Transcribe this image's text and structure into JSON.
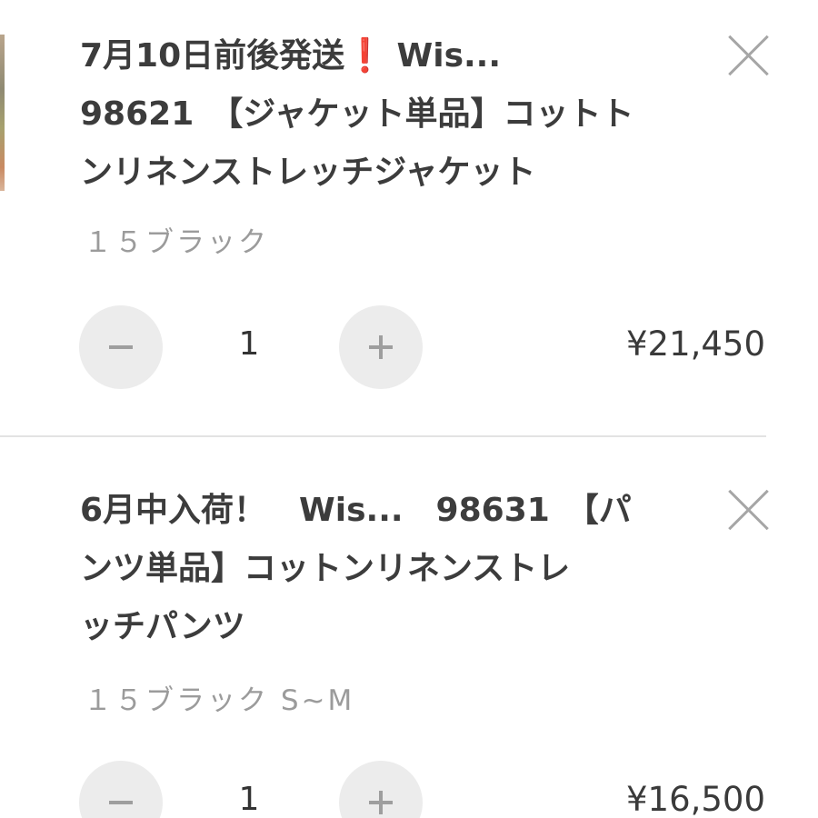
{
  "cart_items": [
    {
      "title_lines": [
        "7月10日前後発送",
        "98621　【ジャケット単品】コットト",
        "ンリネンストレッチジャケット"
      ],
      "title_mark": "❗",
      "title_line1_suffix": "Wis...",
      "variant": "１５ブラック",
      "quantity": "1",
      "price": "¥21,450",
      "remove_icon": "close-icon",
      "decrement_icon": "minus-icon",
      "increment_icon": "plus-icon"
    },
    {
      "title_lines": [
        "6月中入荷！　Wis...　98631　【パ",
        "ンツ単品】コットンリネンストレ",
        "ッチパンツ"
      ],
      "variant": "１５ブラック S~M",
      "quantity": "1",
      "price": "¥16,500",
      "remove_icon": "close-icon",
      "decrement_icon": "minus-icon",
      "increment_icon": "plus-icon"
    }
  ],
  "colors": {
    "title": "#3c3c3c",
    "variant": "#9b9b9b",
    "stepper_bg": "#ececec",
    "divider": "#e3e3e3",
    "exclamation": "#e0262b"
  }
}
